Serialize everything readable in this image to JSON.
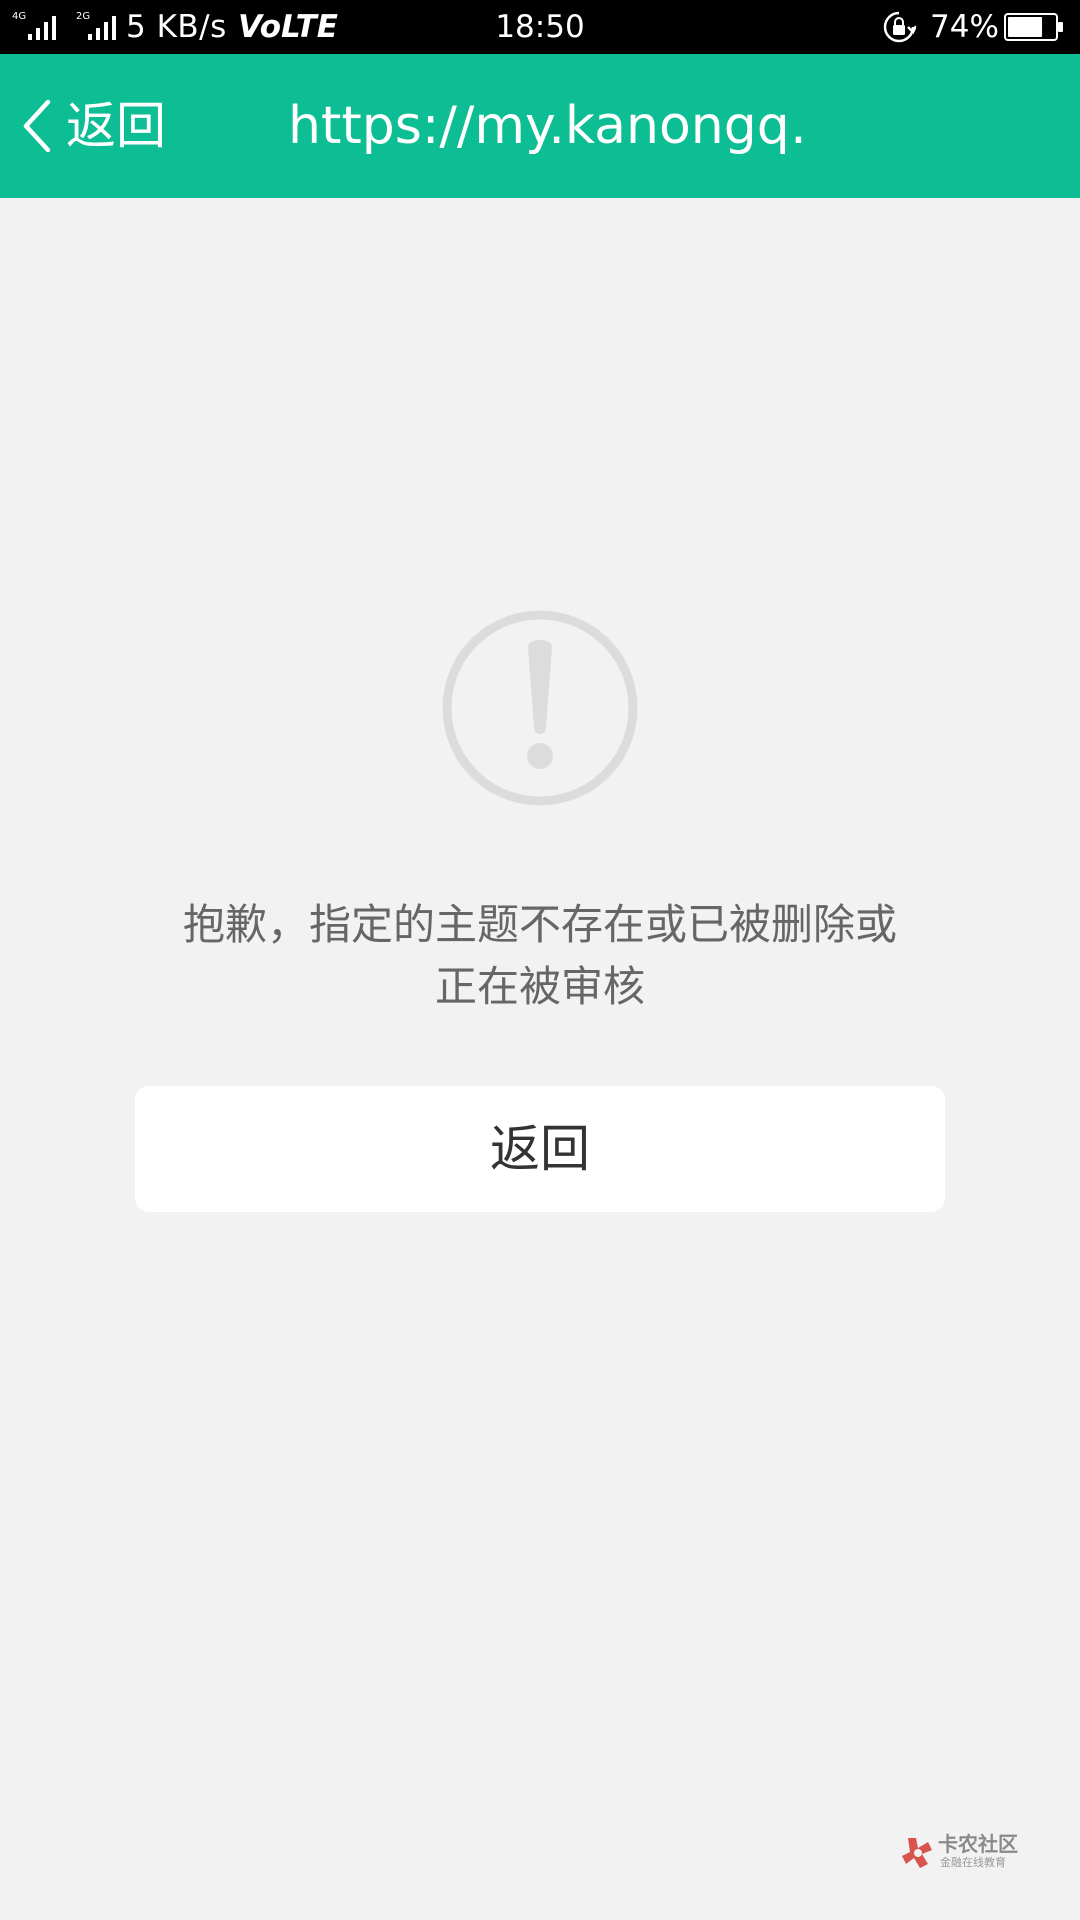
{
  "status_bar": {
    "network_primary": "4G",
    "network_secondary": "2G",
    "net_speed": "5 KB/s",
    "volte": "VoLTE",
    "time": "18:50",
    "battery_percent": "74%",
    "battery_level": 0.74,
    "icons": [
      "signal-icon",
      "signal-icon",
      "rotation-lock-icon",
      "battery-icon"
    ]
  },
  "header": {
    "back_label": "返回",
    "title": "https://my.kanongq…",
    "background_color": "#0dbd94"
  },
  "main": {
    "icon": "exclamation-circle-icon",
    "message_line1": "抱歉，指定的主题不存在或已被删除或",
    "message_line2": "正在被审核",
    "button_label": "返回"
  },
  "watermark": {
    "name": "卡农社区",
    "tagline": "金融在线教育"
  }
}
